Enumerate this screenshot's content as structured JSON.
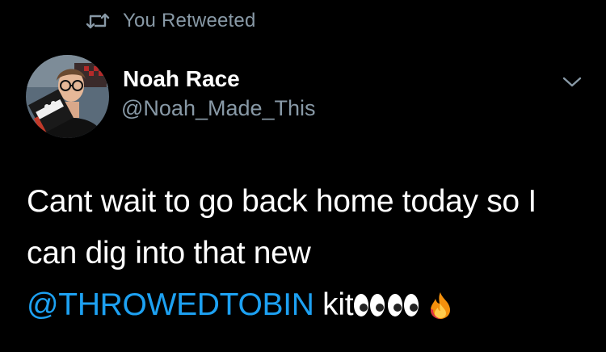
{
  "retweet": {
    "icon": "retweet-icon",
    "label": "You Retweeted"
  },
  "author": {
    "name": "Noah Race",
    "handle": "@Noah_Made_This"
  },
  "tweet": {
    "line1": "Cant wait to go back home today so I",
    "line2": "can dig into that new",
    "mention": "@THROWEDTOBIN",
    "trailing": " kit",
    "emojis": [
      "eyes-emoji",
      "eyes-emoji",
      "fire-emoji"
    ]
  },
  "colors": {
    "background": "#000000",
    "muted": "#8899a6",
    "link": "#1da1f2",
    "text": "#ffffff"
  }
}
